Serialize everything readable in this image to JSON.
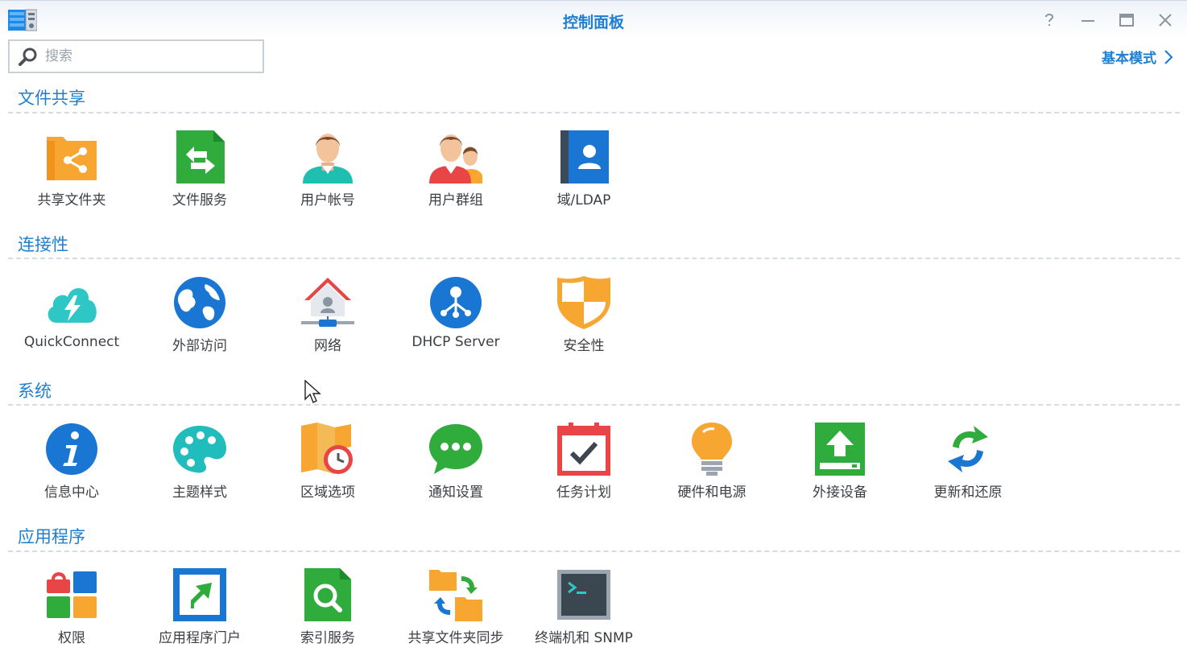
{
  "window": {
    "title": "控制面板",
    "controls": [
      "help",
      "minimize",
      "maximize",
      "close"
    ]
  },
  "search": {
    "placeholder": "搜索",
    "value": ""
  },
  "mode_toggle": {
    "label": "基本模式"
  },
  "colors": {
    "accent": "#1e7fd0",
    "section_text": "#1e7fd0",
    "divider": "#d4dde6"
  },
  "sections": [
    {
      "title": "文件共享",
      "items": [
        {
          "label": "共享文件夹",
          "icon": "shared-folder-icon"
        },
        {
          "label": "文件服务",
          "icon": "file-services-icon"
        },
        {
          "label": "用户帐号",
          "icon": "user-icon"
        },
        {
          "label": "用户群组",
          "icon": "group-icon"
        },
        {
          "label": "域/LDAP",
          "icon": "ldap-icon"
        }
      ]
    },
    {
      "title": "连接性",
      "items": [
        {
          "label": "QuickConnect",
          "icon": "quickconnect-icon"
        },
        {
          "label": "外部访问",
          "icon": "globe-icon"
        },
        {
          "label": "网络",
          "icon": "network-house-icon"
        },
        {
          "label": "DHCP Server",
          "icon": "dhcp-icon"
        },
        {
          "label": "安全性",
          "icon": "shield-icon"
        }
      ]
    },
    {
      "title": "系统",
      "items": [
        {
          "label": "信息中心",
          "icon": "info-icon"
        },
        {
          "label": "主题样式",
          "icon": "palette-icon"
        },
        {
          "label": "区域选项",
          "icon": "map-clock-icon"
        },
        {
          "label": "通知设置",
          "icon": "chat-bubble-icon"
        },
        {
          "label": "任务计划",
          "icon": "calendar-check-icon"
        },
        {
          "label": "硬件和电源",
          "icon": "lightbulb-icon"
        },
        {
          "label": "外接设备",
          "icon": "external-device-icon"
        },
        {
          "label": "更新和还原",
          "icon": "update-restore-icon"
        }
      ]
    },
    {
      "title": "应用程序",
      "items": [
        {
          "label": "权限",
          "icon": "privileges-icon"
        },
        {
          "label": "应用程序门户",
          "icon": "app-portal-icon"
        },
        {
          "label": "索引服务",
          "icon": "indexing-icon"
        },
        {
          "label": "共享文件夹同步",
          "icon": "folder-sync-icon"
        },
        {
          "label": "终端机和 SNMP",
          "icon": "terminal-icon"
        }
      ]
    }
  ]
}
